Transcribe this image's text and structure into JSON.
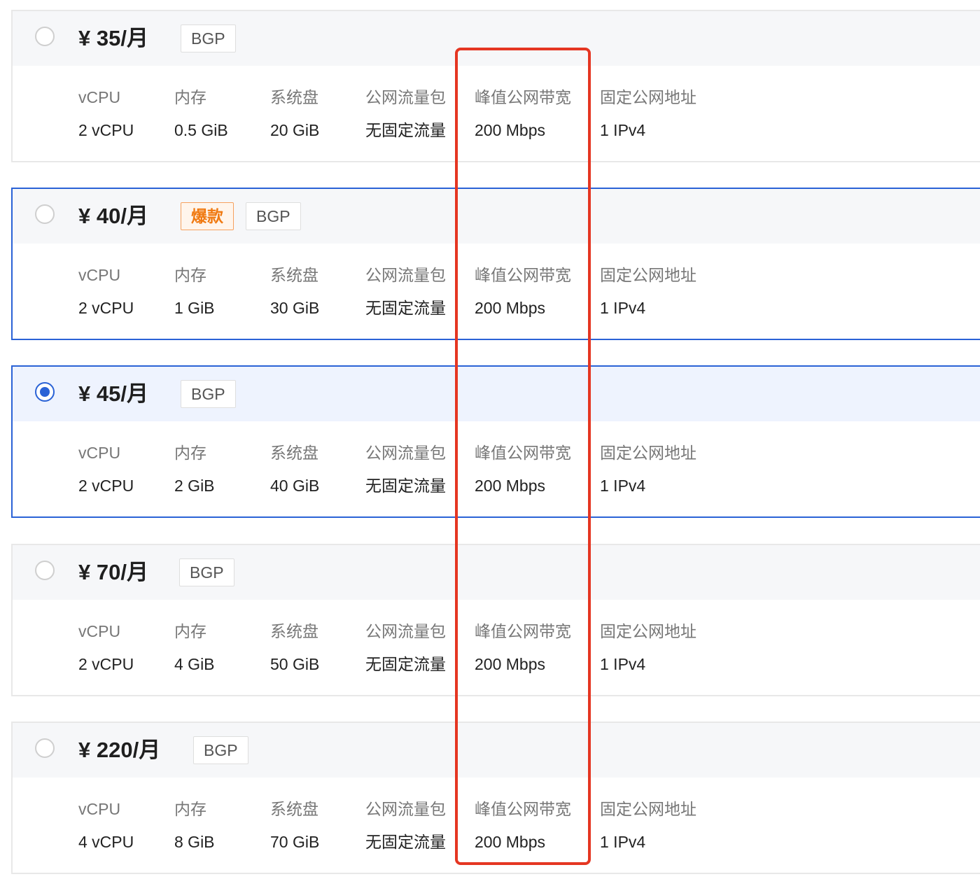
{
  "currency_symbol": "¥",
  "spec_labels": [
    "vCPU",
    "内存",
    "系统盘",
    "公网流量包",
    "峰值公网带宽",
    "固定公网地址"
  ],
  "plans": [
    {
      "price": "¥ 35/月",
      "tags": [
        "BGP"
      ],
      "selected": false,
      "values": [
        "2 vCPU",
        "0.5 GiB",
        "20 GiB",
        "无固定流量",
        "200 Mbps",
        "1 IPv4"
      ]
    },
    {
      "price": "¥ 40/月",
      "tags": [
        "爆款",
        "BGP"
      ],
      "selected": false,
      "values": [
        "2 vCPU",
        "1 GiB",
        "30 GiB",
        "无固定流量",
        "200 Mbps",
        "1 IPv4"
      ]
    },
    {
      "price": "¥ 45/月",
      "tags": [
        "BGP"
      ],
      "selected": true,
      "values": [
        "2 vCPU",
        "2 GiB",
        "40 GiB",
        "无固定流量",
        "200 Mbps",
        "1 IPv4"
      ]
    },
    {
      "price": "¥ 70/月",
      "tags": [
        "BGP"
      ],
      "selected": false,
      "values": [
        "2 vCPU",
        "4 GiB",
        "50 GiB",
        "无固定流量",
        "200 Mbps",
        "1 IPv4"
      ]
    },
    {
      "price": "¥ 220/月",
      "tags": [
        "BGP"
      ],
      "selected": false,
      "values": [
        "4 vCPU",
        "8 GiB",
        "70 GiB",
        "无固定流量",
        "200 Mbps",
        "1 IPv4"
      ]
    }
  ],
  "colors": {
    "selected_border": "#2a62d6",
    "highlight_box": "#e53622",
    "hot_tag": "#f07a12"
  }
}
